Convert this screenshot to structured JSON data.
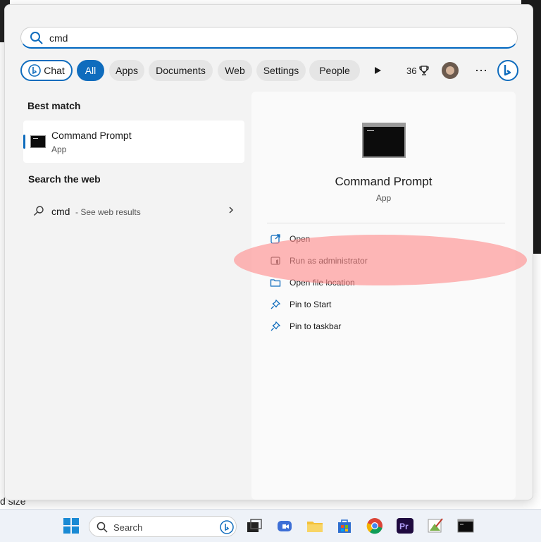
{
  "search": {
    "query": "cmd"
  },
  "filters": {
    "chat": "Chat",
    "all": "All",
    "apps": "Apps",
    "documents": "Documents",
    "web": "Web",
    "settings": "Settings",
    "people": "People",
    "points": "36"
  },
  "left": {
    "best_match_title": "Best match",
    "best_match": {
      "name": "Command Prompt",
      "type": "App"
    },
    "search_web_title": "Search the web",
    "web_result": {
      "query": "cmd",
      "hint": "- See web results"
    }
  },
  "detail": {
    "name": "Command Prompt",
    "type": "App",
    "actions": [
      {
        "label": "Open",
        "icon": "open-external-icon"
      },
      {
        "label": "Run as administrator",
        "icon": "shield-icon"
      },
      {
        "label": "Open file location",
        "icon": "folder-icon"
      },
      {
        "label": "Pin to Start",
        "icon": "pin-icon"
      },
      {
        "label": "Pin to taskbar",
        "icon": "pin-icon"
      }
    ]
  },
  "background": {
    "size_fragment": "d size"
  },
  "taskbar": {
    "search_label": "Search"
  },
  "colors": {
    "accent": "#0f6cbd",
    "highlight": "#ff8c8c"
  }
}
